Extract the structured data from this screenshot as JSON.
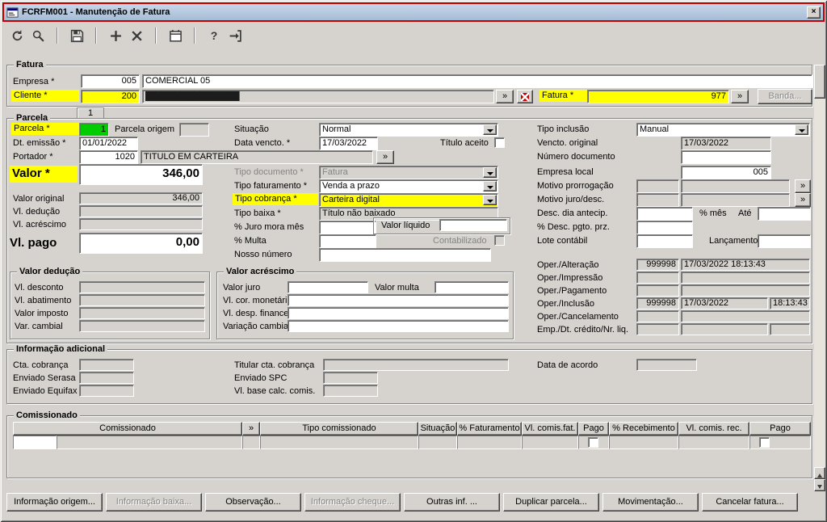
{
  "window": {
    "title": "FCRFM001 - Manutenção de Fatura"
  },
  "icons": {
    "lookup": "»",
    "close": "×",
    "help": "?"
  },
  "toolbar": {
    "icons": [
      "refresh",
      "search",
      "save",
      "add",
      "delete",
      "calendar",
      "help",
      "exit"
    ]
  },
  "fatura": {
    "legend": "Fatura",
    "empresa_label": "Empresa *",
    "empresa_code": "005",
    "empresa_name": "COMERCIAL 05",
    "cliente_label": "Cliente *",
    "cliente_code": "200",
    "cliente_name_masked": "███████████████████",
    "fatura_label": "Fatura *",
    "fatura_value": "977",
    "banda_button": "Banda..."
  },
  "parcela": {
    "legend": "Parcela",
    "tab": "1",
    "parcela_label": "Parcela *",
    "parcela_value": "1",
    "parcela_origem_label": "Parcela origem",
    "dt_emissao_label": "Dt. emissão *",
    "dt_emissao_value": "01/01/2022",
    "portador_label": "Portador *",
    "portador_code": "1020",
    "portador_name": "TITULO EM CARTEIRA",
    "valor_label": "Valor *",
    "valor_value": "346,00",
    "valor_original_label": "Valor original",
    "valor_original_value": "346,00",
    "vl_deducao_label": "Vl. dedução",
    "vl_acrescimo_label": "Vl. acréscimo",
    "vl_pago_label": "Vl. pago",
    "vl_pago_value": "0,00",
    "situacao_label": "Situação",
    "situacao_value": "Normal",
    "data_vencto_label": "Data vencto. *",
    "data_vencto_value": "17/03/2022",
    "titulo_aceito_label": "Título aceito",
    "tipo_documento_label": "Tipo documento *",
    "tipo_documento_value": "Fatura",
    "tipo_faturamento_label": "Tipo faturamento *",
    "tipo_faturamento_value": "Venda a prazo",
    "tipo_cobranca_label": "Tipo cobrança *",
    "tipo_cobranca_value": "Carteira digital",
    "tipo_baixa_label": "Tipo baixa *",
    "tipo_baixa_value": "Título não baixado",
    "juro_mora_label": "% Juro mora mês",
    "valor_liquido_label": "Valor líquido",
    "multa_label": "% Multa",
    "contabilizado_label": "Contabilizado",
    "nosso_numero_label": "Nosso número",
    "tipo_inclusao_label": "Tipo inclusão",
    "tipo_inclusao_value": "Manual",
    "vencto_original_label": "Vencto. original",
    "vencto_original_value": "17/03/2022",
    "numero_documento_label": "Número documento",
    "empresa_local_label": "Empresa local",
    "empresa_local_value": "005",
    "motivo_prorrogacao_label": "Motivo prorrogação",
    "motivo_juro_desc_label": "Motivo juro/desc.",
    "desc_dia_antecip_label": "Desc. dia antecip.",
    "pct_mes_label": "% mês",
    "ate_label": "Até",
    "desc_pgto_prz_label": "% Desc. pgto. prz.",
    "lote_contabil_label": "Lote contábil",
    "lancamento_label": "Lançamento",
    "oper_alteracao_label": "Oper./Alteração",
    "oper_alteracao_oper": "999998",
    "oper_alteracao_datetime": "17/03/2022 18:13:43",
    "oper_impressao_label": "Oper./Impressão",
    "oper_pagamento_label": "Oper./Pagamento",
    "oper_inclusao_label": "Oper./Inclusão",
    "oper_inclusao_oper": "999998",
    "oper_inclusao_date": "17/03/2022",
    "oper_inclusao_time": "18:13:43",
    "oper_cancelamento_label": "Oper./Cancelamento",
    "emp_dt_credito_label": "Emp./Dt. crédito/Nr. liq."
  },
  "valor_deducao": {
    "legend": "Valor dedução",
    "vl_desconto_label": "Vl. desconto",
    "vl_abatimento_label": "Vl. abatimento",
    "valor_imposto_label": "Valor imposto",
    "var_cambial_label": "Var. cambial"
  },
  "valor_acrescimo": {
    "legend": "Valor acréscimo",
    "valor_juro_label": "Valor juro",
    "valor_multa_label": "Valor multa",
    "vl_cor_monetaria_label": "Vl. cor. monetária",
    "vl_desp_financeira_label": "Vl. desp. financeira",
    "variacao_cambial_label": "Variação cambial"
  },
  "info_adicional": {
    "legend": "Informação adicional",
    "cta_cobranca_label": "Cta. cobrança",
    "enviado_serasa_label": "Enviado Serasa",
    "enviado_equifax_label": "Enviado Equifax",
    "titular_cta_label": "Titular cta. cobrança",
    "enviado_spc_label": "Enviado SPC",
    "vl_base_calc_label": "Vl. base calc. comis.",
    "data_acordo_label": "Data de acordo"
  },
  "comissionado": {
    "legend": "Comissionado",
    "headers": [
      "Comissionado",
      "»",
      "Tipo comissionado",
      "Situação",
      "% Faturamento",
      "Vl. comis.fat.",
      "Pago",
      "% Recebimento",
      "Vl. comis. rec.",
      "Pago"
    ]
  },
  "footer_buttons": {
    "info_origem": "Informação origem...",
    "info_baixa": "Informação baixa...",
    "observacao": "Observação...",
    "info_cheque": "Informação cheque...",
    "outras_inf": "Outras inf. ...",
    "duplicar": "Duplicar parcela...",
    "movimentacao": "Movimentação...",
    "cancelar": "Cancelar fatura..."
  },
  "colors": {
    "highlight": "#ffff00",
    "required_green": "#00cc00",
    "titlebar_border": "#c40000"
  }
}
